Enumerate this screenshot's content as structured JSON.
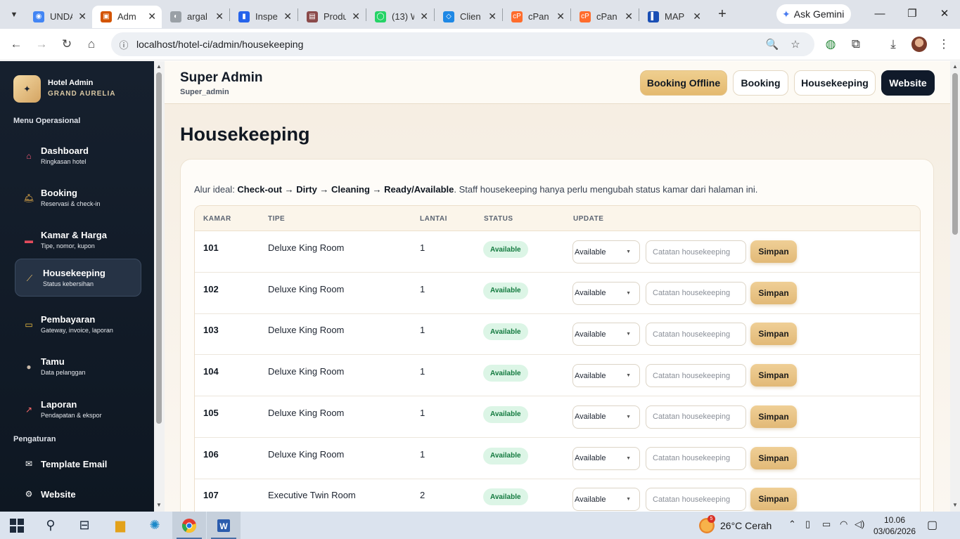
{
  "browser": {
    "tabs": [
      {
        "title": "UNDA",
        "color": "#4285f4",
        "glyph": "◉"
      },
      {
        "title": "Adm",
        "color": "#d35400",
        "glyph": "▣",
        "active": true
      },
      {
        "title": "argal",
        "color": "#9aa0a6",
        "glyph": "◐"
      },
      {
        "title": "Inspe",
        "color": "#2563eb",
        "glyph": "▮"
      },
      {
        "title": "Produ",
        "color": "#8b4a4a",
        "glyph": "▤"
      },
      {
        "title": "(13) W",
        "color": "#25d366",
        "glyph": "◯"
      },
      {
        "title": "Clien",
        "color": "#1e88e5",
        "glyph": "◇"
      },
      {
        "title": "cPan",
        "color": "#ff6c2c",
        "glyph": "cP"
      },
      {
        "title": "cPan",
        "color": "#ff6c2c",
        "glyph": "cP"
      },
      {
        "title": "MAP",
        "color": "#1a4fb5",
        "glyph": "▌"
      }
    ],
    "gemini_label": "Ask Gemini",
    "url": "localhost/hotel-ci/admin/housekeeping"
  },
  "sidebar": {
    "brand_title": "Hotel Admin",
    "brand_subtitle": "GRAND AURELIA",
    "section_ops": "Menu Operasional",
    "ops_items": [
      {
        "label": "Dashboard",
        "sub": "Ringkasan hotel",
        "icon": "home-icon",
        "glyph": "⌂",
        "color": "#ff5c7a"
      },
      {
        "label": "Booking",
        "sub": "Reservasi & check-in",
        "icon": "bell-icon",
        "glyph": "🛎",
        "color": "#f7b84b"
      },
      {
        "label": "Kamar & Harga",
        "sub": "Tipe, nomor, kupon",
        "icon": "bed-icon",
        "glyph": "▬",
        "color": "#e34b5c"
      },
      {
        "label": "Housekeeping",
        "sub": "Status kebersihan",
        "icon": "broom-icon",
        "glyph": "⟋",
        "color": "#f2c56b",
        "active": true
      },
      {
        "label": "Pembayaran",
        "sub": "Gateway, invoice, laporan",
        "icon": "card-icon",
        "glyph": "▭",
        "color": "#f5c542"
      },
      {
        "label": "Tamu",
        "sub": "Data pelanggan",
        "icon": "user-icon",
        "glyph": "●",
        "color": "#c9b9a8"
      },
      {
        "label": "Laporan",
        "sub": "Pendapatan & ekspor",
        "icon": "chart-icon",
        "glyph": "↗",
        "color": "#ff6b6b"
      }
    ],
    "section_settings": "Pengaturan",
    "settings_items": [
      {
        "label": "Template Email",
        "icon": "mail-icon",
        "glyph": "✉"
      },
      {
        "label": "Website",
        "icon": "gear-icon",
        "glyph": "⚙"
      }
    ]
  },
  "header": {
    "admin_name": "Super Admin",
    "admin_role": "Super_admin",
    "buttons": [
      "Booking Offline",
      "Booking",
      "Housekeeping",
      "Website"
    ]
  },
  "page": {
    "title": "Housekeeping",
    "hint_prefix": "Alur ideal: ",
    "hint_flow": "Check-out → Dirty → Cleaning → Ready/Available",
    "hint_suffix": ". Staff housekeeping hanya perlu mengubah status kamar dari halaman ini.",
    "columns": [
      "KAMAR",
      "TIPE",
      "LANTAI",
      "STATUS",
      "UPDATE"
    ],
    "note_placeholder": "Catatan housekeeping",
    "save_label": "Simpan",
    "rows": [
      {
        "room": "101",
        "type": "Deluxe King Room",
        "floor": "1",
        "status": "Available",
        "update": "Available"
      },
      {
        "room": "102",
        "type": "Deluxe King Room",
        "floor": "1",
        "status": "Available",
        "update": "Available"
      },
      {
        "room": "103",
        "type": "Deluxe King Room",
        "floor": "1",
        "status": "Available",
        "update": "Available"
      },
      {
        "room": "104",
        "type": "Deluxe King Room",
        "floor": "1",
        "status": "Available",
        "update": "Available"
      },
      {
        "room": "105",
        "type": "Deluxe King Room",
        "floor": "1",
        "status": "Available",
        "update": "Available"
      },
      {
        "room": "106",
        "type": "Deluxe King Room",
        "floor": "1",
        "status": "Available",
        "update": "Available"
      },
      {
        "room": "107",
        "type": "Executive Twin Room",
        "floor": "2",
        "status": "Available",
        "update": "Available"
      }
    ]
  },
  "taskbar": {
    "weather_temp": "26°C",
    "weather_text": "Cerah",
    "weather_badge": "5",
    "time": "10.06",
    "date": "03/06/2026"
  }
}
